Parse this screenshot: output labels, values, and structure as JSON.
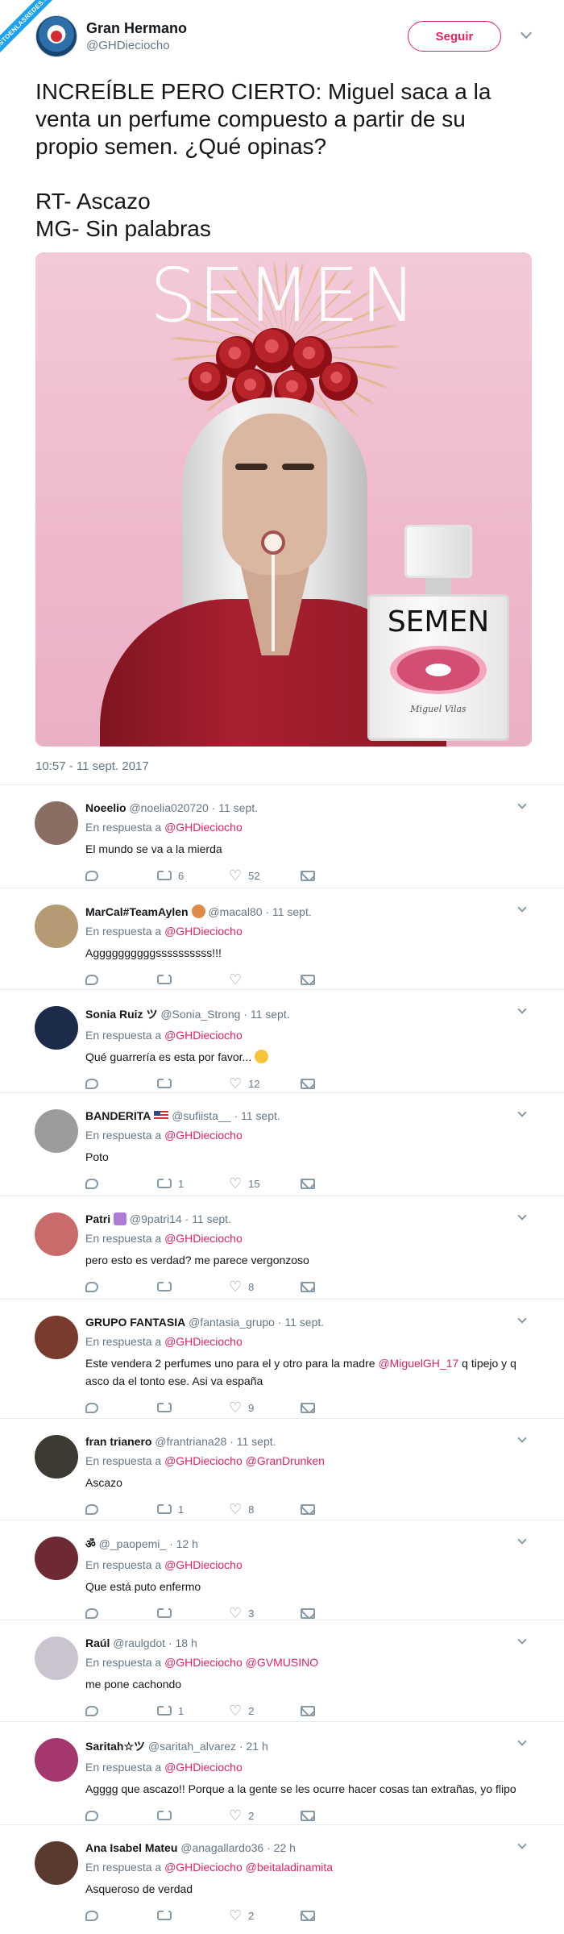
{
  "watermark": "VISTOENLASREDES.COM",
  "tweet": {
    "name": "Gran Hermano",
    "handle": "@GHDieciocho",
    "follow_label": "Seguir",
    "text": "INCREÍBLE PERO CIERTO: Miguel saca a la venta un perfume compuesto a partir de su propio semen. ¿Qué opinas?\n\nRT- Ascazo\nMG- Sin palabras",
    "image_title": "SEMEN",
    "bottle_label": "SEMEN",
    "bottle_signature": "Miguel Vilas",
    "timestamp": "10:57 - 11 sept. 2017"
  },
  "replies": [
    {
      "name": "Noeelio",
      "handle": "@noelia020720",
      "time": "· 11 sept.",
      "in_reply": "En respuesta a",
      "mentions": "@GHDieciocho",
      "text": "El mundo se va a la mierda",
      "retweets": "6",
      "likes": "52",
      "avatar_color": "#8a6e64"
    },
    {
      "name": "MarCal#TeamAylen",
      "handle": "@macal80",
      "time": "· 11 sept.",
      "in_reply": "En respuesta a",
      "mentions": "@GHDieciocho",
      "text": "Aggggggggggssssssssss!!!",
      "retweets": "",
      "likes": "",
      "avatar_color": "#b59a74"
    },
    {
      "name": "Sonia Ruiz ツ",
      "handle": "@Sonia_Strong",
      "time": "· 11 sept.",
      "in_reply": "En respuesta a",
      "mentions": "@GHDieciocho",
      "text": "Qué guarrería es esta por favor...",
      "retweets": "",
      "likes": "12",
      "avatar_color": "#1d2b4a"
    },
    {
      "name": "BANDERITA",
      "handle": "@sufiista__",
      "time": "· 11 sept.",
      "in_reply": "En respuesta a",
      "mentions": "@GHDieciocho",
      "text": "Poto",
      "retweets": "1",
      "likes": "15",
      "avatar_color": "#9c9c9c"
    },
    {
      "name": "Patri",
      "handle": "@9patri14",
      "time": "· 11 sept.",
      "in_reply": "En respuesta a",
      "mentions": "@GHDieciocho",
      "text": "pero esto es verdad? me parece vergonzoso",
      "retweets": "",
      "likes": "8",
      "avatar_color": "#c96b6b"
    },
    {
      "name": "GRUPO FANTASIA",
      "handle": "@fantasia_grupo",
      "time": "· 11 sept.",
      "in_reply": "En respuesta a",
      "mentions": "@GHDieciocho",
      "text_a": "Este vendera 2 perfumes uno para el y otro para la madre",
      "text_link": "@MiguelGH_17",
      "text_b": "q tipejo y q asco da el tonto ese. Asi va españa",
      "retweets": "",
      "likes": "9",
      "avatar_color": "#7a3b2f"
    },
    {
      "name": "fran trianero",
      "handle": "@frantriana28",
      "time": "· 11 sept.",
      "in_reply": "En respuesta a",
      "mentions": "@GHDieciocho @GranDrunken",
      "text": "Ascazo",
      "retweets": "1",
      "likes": "8",
      "avatar_color": "#3d3a33"
    },
    {
      "name": "ॐ",
      "handle": "@_paopemi_",
      "time": "· 12 h",
      "in_reply": "En respuesta a",
      "mentions": "@GHDieciocho",
      "text": "Que está puto enfermo",
      "retweets": "",
      "likes": "3",
      "avatar_color": "#6e2a34"
    },
    {
      "name": "Raúl",
      "handle": "@raulgdot",
      "time": "· 18 h",
      "in_reply": "En respuesta a",
      "mentions": "@GHDieciocho @GVMUSINO",
      "text": "me pone cachondo",
      "retweets": "1",
      "likes": "2",
      "avatar_color": "#c9c4cf"
    },
    {
      "name": "Saritah☆ツ",
      "handle": "@saritah_alvarez",
      "time": "· 21 h",
      "in_reply": "En respuesta a",
      "mentions": "@GHDieciocho",
      "text": "Agggg que ascazo!! Porque a la gente se les ocurre hacer cosas tan extrañas, yo flipo",
      "retweets": "",
      "likes": "2",
      "avatar_color": "#a3376e"
    },
    {
      "name": "Ana Isabel Mateu",
      "handle": "@anagallardo36",
      "time": "· 22 h",
      "in_reply": "En respuesta a",
      "mentions": "@GHDieciocho @beitaladinamita",
      "text": "Asqueroso de verdad",
      "retweets": "",
      "likes": "2",
      "avatar_color": "#5a3a2e"
    }
  ]
}
